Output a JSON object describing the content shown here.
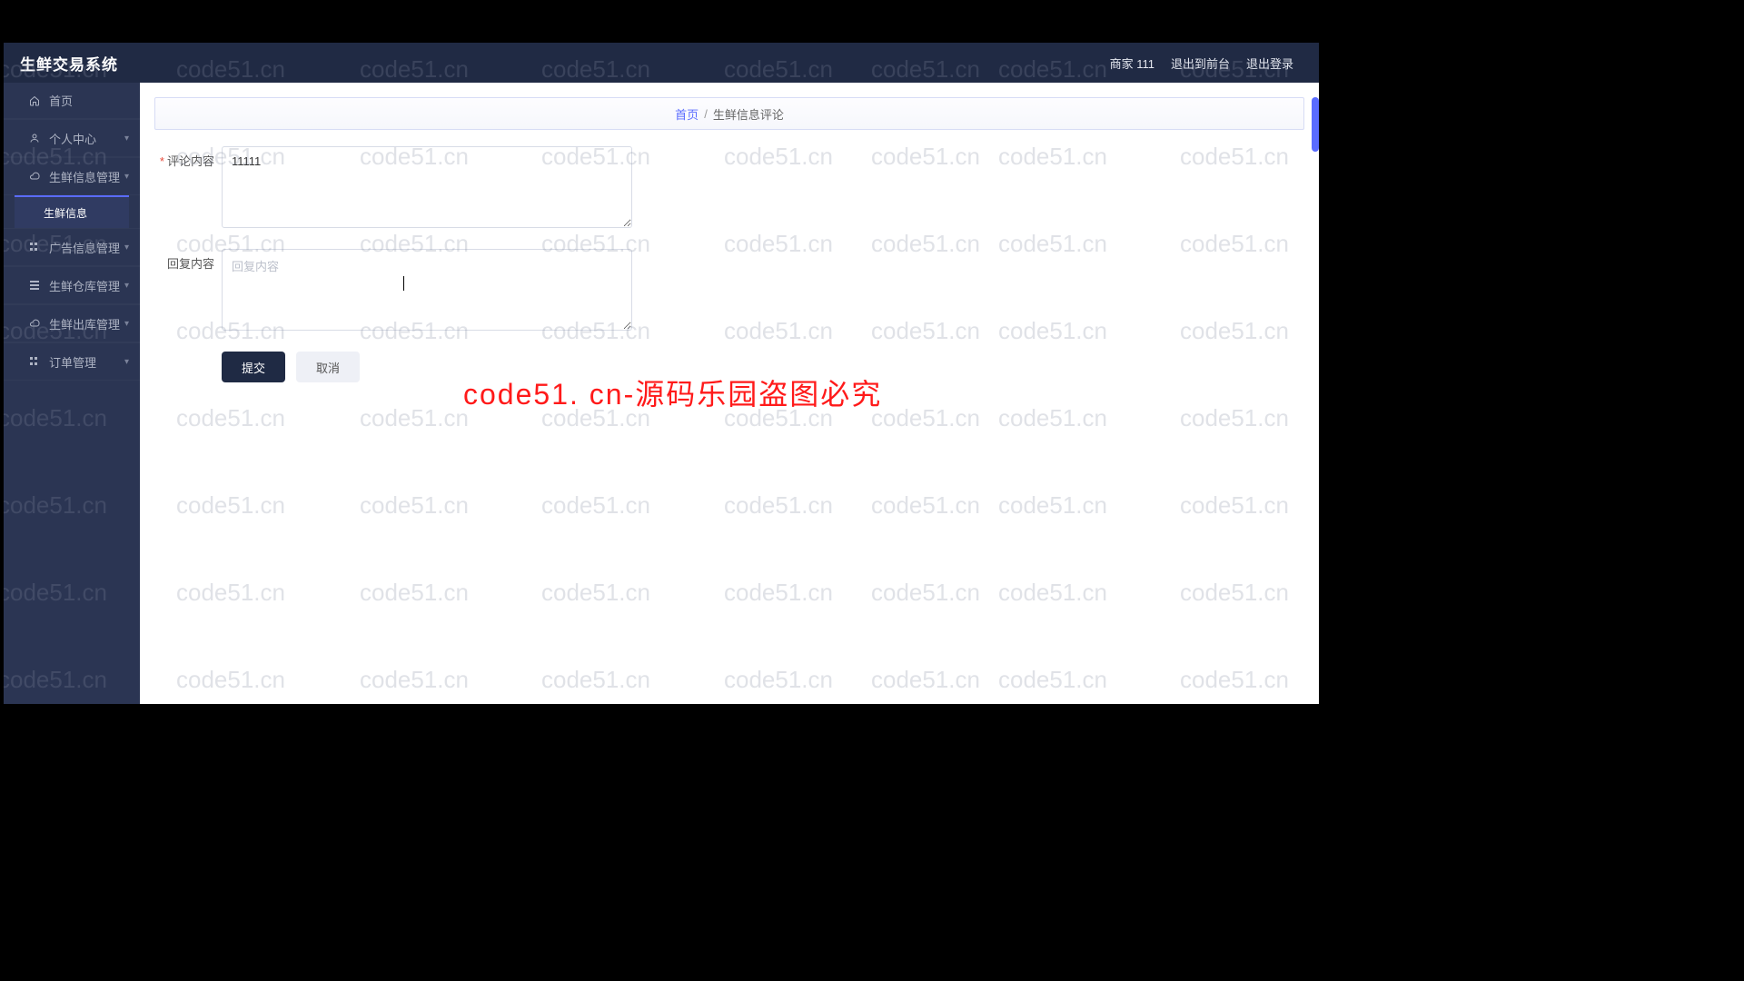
{
  "app": {
    "title": "生鲜交易系统"
  },
  "header": {
    "merchant_label": "商家 111",
    "goto_front": "退出到前台",
    "logout": "退出登录"
  },
  "sidebar": {
    "items": [
      {
        "icon": "home",
        "label": "首页",
        "expandable": false
      },
      {
        "icon": "user",
        "label": "个人中心",
        "expandable": true
      },
      {
        "icon": "cloud",
        "label": "生鲜信息管理",
        "expandable": true
      },
      {
        "icon": "grid",
        "label": "广告信息管理",
        "expandable": true
      },
      {
        "icon": "bars",
        "label": "生鲜仓库管理",
        "expandable": true
      },
      {
        "icon": "cloud",
        "label": "生鲜出库管理",
        "expandable": true
      },
      {
        "icon": "grid",
        "label": "订单管理",
        "expandable": true
      }
    ],
    "active_sub": "生鲜信息"
  },
  "breadcrumb": {
    "home": "首页",
    "sep": "/",
    "current": "生鲜信息评论"
  },
  "form": {
    "comment_label": "评论内容",
    "comment_value": "11111",
    "reply_label": "回复内容",
    "reply_placeholder": "回复内容",
    "reply_value": "",
    "submit": "提交",
    "cancel": "取消"
  },
  "watermark": {
    "text": "code51.cn",
    "red": "code51. cn-源码乐园盗图必究"
  }
}
